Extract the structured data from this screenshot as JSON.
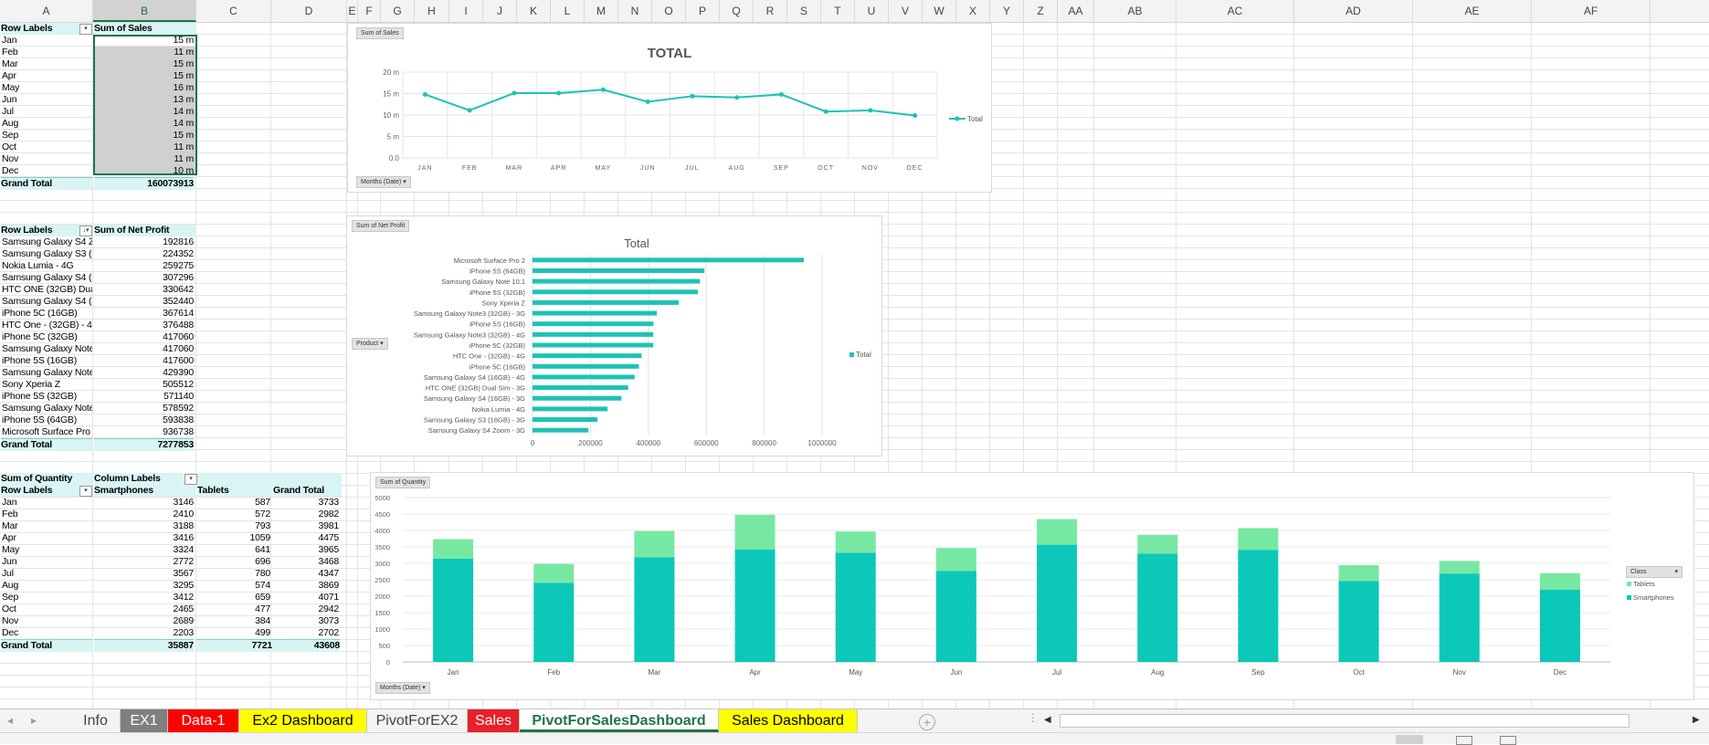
{
  "columns": [
    "A",
    "B",
    "C",
    "D",
    "E",
    "F",
    "G",
    "H",
    "I",
    "J",
    "K",
    "L",
    "M",
    "N",
    "O",
    "P",
    "Q",
    "R",
    "S",
    "T",
    "U",
    "V",
    "W",
    "X",
    "Y",
    "Z",
    "AA",
    "AB",
    "AC",
    "AD",
    "AE",
    "AF"
  ],
  "pivot1": {
    "header": {
      "row_labels": "Row Labels",
      "value_label": "Sum of Sales"
    },
    "rows": [
      {
        "label": "Jan",
        "value": "15 m"
      },
      {
        "label": "Feb",
        "value": "11 m"
      },
      {
        "label": "Mar",
        "value": "15 m"
      },
      {
        "label": "Apr",
        "value": "15 m"
      },
      {
        "label": "May",
        "value": "16 m"
      },
      {
        "label": "Jun",
        "value": "13 m"
      },
      {
        "label": "Jul",
        "value": "14 m"
      },
      {
        "label": "Aug",
        "value": "14 m"
      },
      {
        "label": "Sep",
        "value": "15 m"
      },
      {
        "label": "Oct",
        "value": "11 m"
      },
      {
        "label": "Nov",
        "value": "11 m"
      },
      {
        "label": "Dec",
        "value": "10 m"
      }
    ],
    "grand_total": {
      "label": "Grand Total",
      "value": "160073913"
    }
  },
  "pivot2": {
    "header": {
      "row_labels": "Row Labels",
      "value_label": "Sum of Net Profit"
    },
    "rows": [
      {
        "label": "Samsung Galaxy S4 Z",
        "value": "192816"
      },
      {
        "label": "Samsung Galaxy S3 (",
        "value": "224352"
      },
      {
        "label": "Nokia Lumia - 4G",
        "value": "259275"
      },
      {
        "label": "Samsung Galaxy S4 (",
        "value": "307296"
      },
      {
        "label": "HTC ONE (32GB) Dua",
        "value": "330642"
      },
      {
        "label": "Samsung Galaxy S4 (",
        "value": "352440"
      },
      {
        "label": "iPhone 5C (16GB)",
        "value": "367614"
      },
      {
        "label": "HTC One - (32GB) - 4",
        "value": "376488"
      },
      {
        "label": "iPhone 5C (32GB)",
        "value": "417060"
      },
      {
        "label": "Samsung Galaxy Note",
        "value": "417060"
      },
      {
        "label": "iPhone 5S (16GB)",
        "value": "417600"
      },
      {
        "label": "Samsung Galaxy Note",
        "value": "429390"
      },
      {
        "label": "Sony Xperia Z",
        "value": "505512"
      },
      {
        "label": "iPhone 5S (32GB)",
        "value": "571140"
      },
      {
        "label": "Samsung Galaxy Note",
        "value": "578592"
      },
      {
        "label": "iPhone 5S (64GB)",
        "value": "593838"
      },
      {
        "label": "Microsoft Surface Pro",
        "value": "936738"
      }
    ],
    "grand_total": {
      "label": "Grand Total",
      "value": "7277853"
    }
  },
  "pivot3": {
    "header": {
      "values_label": "Sum of Quantity",
      "column_labels": "Column Labels",
      "row_labels": "Row Labels",
      "col1": "Smartphones",
      "col2": "Tablets",
      "col3": "Grand Total"
    },
    "rows": [
      {
        "label": "Jan",
        "c1": "3146",
        "c2": "587",
        "c3": "3733"
      },
      {
        "label": "Feb",
        "c1": "2410",
        "c2": "572",
        "c3": "2982"
      },
      {
        "label": "Mar",
        "c1": "3188",
        "c2": "793",
        "c3": "3981"
      },
      {
        "label": "Apr",
        "c1": "3416",
        "c2": "1059",
        "c3": "4475"
      },
      {
        "label": "May",
        "c1": "3324",
        "c2": "641",
        "c3": "3965"
      },
      {
        "label": "Jun",
        "c1": "2772",
        "c2": "696",
        "c3": "3468"
      },
      {
        "label": "Jul",
        "c1": "3567",
        "c2": "780",
        "c3": "4347"
      },
      {
        "label": "Aug",
        "c1": "3295",
        "c2": "574",
        "c3": "3869"
      },
      {
        "label": "Sep",
        "c1": "3412",
        "c2": "659",
        "c3": "4071"
      },
      {
        "label": "Oct",
        "c1": "2465",
        "c2": "477",
        "c3": "2942"
      },
      {
        "label": "Nov",
        "c1": "2689",
        "c2": "384",
        "c3": "3073"
      },
      {
        "label": "Dec",
        "c1": "2203",
        "c2": "499",
        "c3": "2702"
      }
    ],
    "grand_total": {
      "label": "Grand Total",
      "c1": "35887",
      "c2": "7721",
      "c3": "43608"
    }
  },
  "chart_data": [
    {
      "type": "line",
      "field_button": "Sum of Sales",
      "axis_button": "Months (Date)",
      "title": "TOTAL",
      "categories": [
        "JAN",
        "FEB",
        "MAR",
        "APR",
        "MAY",
        "JUN",
        "JUL",
        "AUG",
        "SEP",
        "OCT",
        "NOV",
        "DEC"
      ],
      "series": [
        {
          "name": "Total",
          "values": [
            14.8,
            11.1,
            15.1,
            15.1,
            15.9,
            13.1,
            14.4,
            14.1,
            14.8,
            10.8,
            11.1,
            9.9
          ]
        }
      ],
      "yticks": [
        "0.0",
        "5 m",
        "10 m",
        "15 m",
        "20 m"
      ],
      "ylim": [
        0,
        20
      ],
      "legend_position": "right",
      "color": "#1ec2b4"
    },
    {
      "type": "bar",
      "orientation": "horizontal",
      "field_button": "Sum of Net Profit",
      "axis_button": "Product",
      "title": "Total",
      "categories": [
        "Microsoft Surface Pro 2",
        "iPhone 5S (64GB)",
        "Samsung Galaxy Note 10.1",
        "iPhone 5S (32GB)",
        "Sony Xperia Z",
        "Samsung Galaxy Note3 (32GB) - 3G",
        "iPhone 5S (16GB)",
        "Samsung Galaxy Note3 (32GB) - 4G",
        "iPhone 5C (32GB)",
        "HTC One - (32GB) - 4G",
        "iPhone 5C (16GB)",
        "Samsung Galaxy S4 (16GB) - 4G",
        "HTC ONE (32GB) Dual Sim - 3G",
        "Samsung Galaxy S4  (16GB) - 3G",
        "Nokia Lumia  - 4G",
        "Samsung Galaxy S3 (16GB) - 3G",
        "Samsung Galaxy S4 Zoom - 3G"
      ],
      "series": [
        {
          "name": "Total",
          "values": [
            936738,
            593838,
            578592,
            571140,
            505512,
            429390,
            417600,
            417060,
            417060,
            376488,
            367614,
            352440,
            330642,
            307296,
            259275,
            224352,
            192816
          ]
        }
      ],
      "xticks": [
        "0",
        "200000",
        "400000",
        "600000",
        "800000",
        "1000000"
      ],
      "xlim": [
        0,
        1000000
      ],
      "legend_position": "right",
      "color": "#1ec2b4"
    },
    {
      "type": "bar",
      "stacked": true,
      "field_button": "Sum of Quantity",
      "axis_button": "Months (Date)",
      "legend_title": "Class",
      "categories": [
        "Jan",
        "Feb",
        "Mar",
        "Apr",
        "May",
        "Jun",
        "Jul",
        "Aug",
        "Sep",
        "Oct",
        "Nov",
        "Dec"
      ],
      "series": [
        {
          "name": "Smartphones",
          "values": [
            3146,
            2410,
            3188,
            3416,
            3324,
            2772,
            3567,
            3295,
            3412,
            2465,
            2689,
            2203
          ],
          "color": "#0cc8b8"
        },
        {
          "name": "Tablets",
          "values": [
            587,
            572,
            793,
            1059,
            641,
            696,
            780,
            574,
            659,
            477,
            384,
            499
          ],
          "color": "#77e8a2"
        }
      ],
      "legend_order": [
        "Tablets",
        "Smartphones"
      ],
      "yticks": [
        "0",
        "500",
        "1000",
        "1500",
        "2000",
        "2500",
        "3000",
        "3500",
        "4000",
        "4500",
        "5000"
      ],
      "ylim": [
        0,
        5000
      ],
      "legend_position": "right"
    }
  ],
  "tabs": [
    {
      "label": "Info",
      "bg": "#f3f3f3",
      "fg": "#444444"
    },
    {
      "label": "EX1",
      "bg": "#7f7f7f",
      "fg": "#ffffff"
    },
    {
      "label": "Data-1",
      "bg": "#ff0000",
      "fg": "#ffffff"
    },
    {
      "label": "Ex2 Dashboard",
      "bg": "#ffff00",
      "fg": "#000000"
    },
    {
      "label": "PivotForEX2",
      "bg": "#f3f3f3",
      "fg": "#444444"
    },
    {
      "label": "Sales",
      "bg": "#e8202a",
      "fg": "#ffffff"
    },
    {
      "label": "PivotForSalesDashboard",
      "bg": "#ffffff",
      "fg": "#217346"
    },
    {
      "label": "Sales Dashboard",
      "bg": "#ffff00",
      "fg": "#000000"
    }
  ],
  "colors": {
    "accent": "#217346",
    "pivot_header": "#d9f4f4"
  }
}
